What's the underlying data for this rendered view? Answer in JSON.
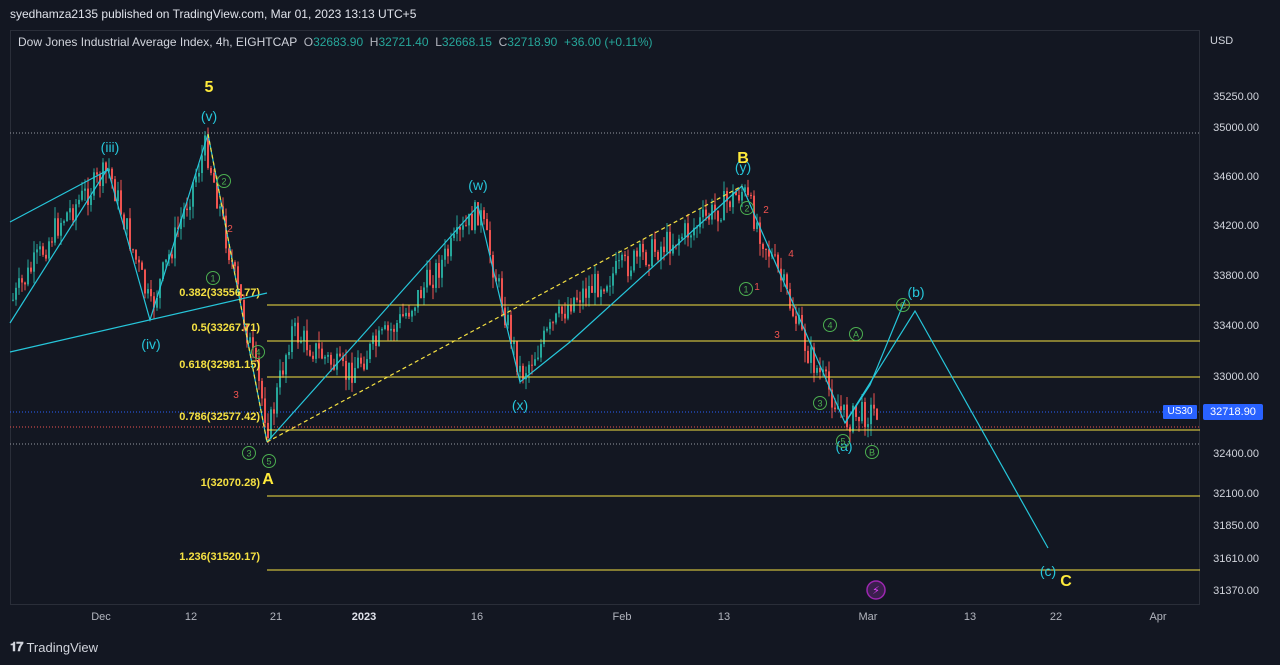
{
  "header": {
    "publisher": "syedhamza2135 published on TradingView.com, Mar 01, 2023 13:13 UTC+5"
  },
  "legend": {
    "symbol": "Dow Jones Industrial Average Index, 4h, EIGHTCAP",
    "open_label": "O",
    "open": "32683.90",
    "high_label": "H",
    "high": "32721.40",
    "low_label": "L",
    "low": "32668.15",
    "close_label": "C",
    "close": "32718.90",
    "change": "+36.00 (+0.11%)"
  },
  "axis": {
    "currency": "USD",
    "price_ticks": [
      "35250.00",
      "35000.00",
      "34600.00",
      "34200.00",
      "33800.00",
      "33400.00",
      "33000.00",
      "32400.00",
      "32100.00",
      "31850.00",
      "31610.00",
      "31370.00"
    ],
    "time_ticks": [
      "Dec",
      "12",
      "21",
      "2023",
      "16",
      "Feb",
      "13",
      "Mar",
      "13",
      "22",
      "Apr"
    ]
  },
  "current_price": {
    "symbol": "US30",
    "value": "32718.90"
  },
  "fib_levels": [
    "0.382(33556.77)",
    "0.5(33267.71)",
    "0.618(32981.15)",
    "0.786(32577.42)",
    "1(32070.28)",
    "1.236(31520.17)"
  ],
  "wave_labels": {
    "major": [
      "5",
      "B",
      "A",
      "C"
    ],
    "intermediate": [
      "(iii)",
      "(v)",
      "(iv)",
      "(w)",
      "(x)",
      "(y)",
      "(b)",
      "(a)",
      "(c)"
    ],
    "circled": [
      "2",
      "1",
      "4",
      "3",
      "5",
      "2",
      "1",
      "4",
      "3",
      "5",
      "A",
      "B",
      "C"
    ],
    "red": [
      "2",
      "3",
      "2",
      "1",
      "4",
      "3"
    ]
  },
  "footer": {
    "brand": "TradingView"
  },
  "colors": {
    "background": "#131722",
    "wave_line": "#26c6da",
    "fib_line": "#f5e142",
    "up_candle": "#26a69a",
    "down_candle": "#ef5350",
    "major_label": "#ffeb3b"
  }
}
